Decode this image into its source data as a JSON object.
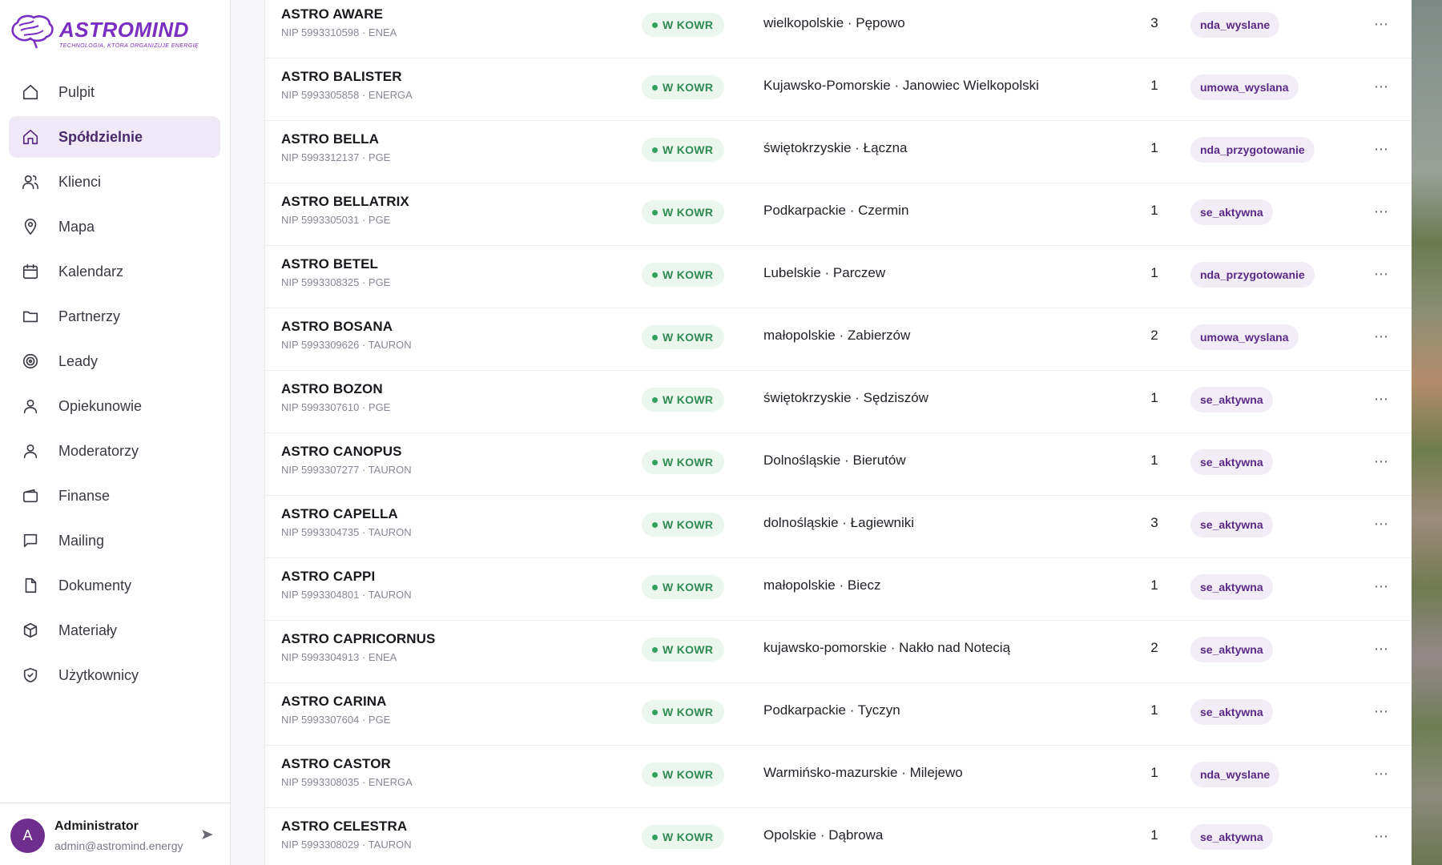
{
  "brand": {
    "name": "ASTROMIND",
    "tagline": "TECHNOLOGIA, KTÓRA ORGANIZUJE ENERGIĘ",
    "color": "#7a2fc2"
  },
  "sidebar": {
    "items": [
      {
        "label": "Pulpit",
        "icon": "home-icon"
      },
      {
        "label": "Spółdzielnie",
        "icon": "house-icon",
        "active": true
      },
      {
        "label": "Klienci",
        "icon": "users-icon"
      },
      {
        "label": "Mapa",
        "icon": "map-pin-icon"
      },
      {
        "label": "Kalendarz",
        "icon": "calendar-icon"
      },
      {
        "label": "Partnerzy",
        "icon": "folder-icon"
      },
      {
        "label": "Leady",
        "icon": "target-icon"
      },
      {
        "label": "Opiekunowie",
        "icon": "user-icon"
      },
      {
        "label": "Moderatorzy",
        "icon": "user-icon"
      },
      {
        "label": "Finanse",
        "icon": "wallet-icon"
      },
      {
        "label": "Mailing",
        "icon": "message-icon"
      },
      {
        "label": "Dokumenty",
        "icon": "file-icon"
      },
      {
        "label": "Materiały",
        "icon": "box-icon"
      },
      {
        "label": "Użytkownicy",
        "icon": "shield-icon"
      }
    ]
  },
  "user": {
    "initial": "A",
    "name": "Administrator",
    "email": "admin@astromind.energy"
  },
  "rows": [
    {
      "name": "ASTRO AWARE",
      "sub": "NIP 5993310598 · ENEA",
      "status": "W KOWR",
      "location": "wielkopolskie · Pępowo",
      "count": "3",
      "tag": "nda_wyslane"
    },
    {
      "name": "ASTRO BALISTER",
      "sub": "NIP 5993305858 · ENERGA",
      "status": "W KOWR",
      "location": "Kujawsko-Pomorskie · Janowiec Wielkopolski",
      "count": "1",
      "tag": "umowa_wyslana"
    },
    {
      "name": "ASTRO BELLA",
      "sub": "NIP 5993312137 · PGE",
      "status": "W KOWR",
      "location": "świętokrzyskie · Łączna",
      "count": "1",
      "tag": "nda_przygotowanie"
    },
    {
      "name": "ASTRO BELLATRIX",
      "sub": "NIP 5993305031 · PGE",
      "status": "W KOWR",
      "location": "Podkarpackie · Czermin",
      "count": "1",
      "tag": "se_aktywna"
    },
    {
      "name": "ASTRO BETEL",
      "sub": "NIP 5993308325 · PGE",
      "status": "W KOWR",
      "location": "Lubelskie · Parczew",
      "count": "1",
      "tag": "nda_przygotowanie"
    },
    {
      "name": "ASTRO BOSANA",
      "sub": "NIP 5993309626 · TAURON",
      "status": "W KOWR",
      "location": "małopolskie · Zabierzów",
      "count": "2",
      "tag": "umowa_wyslana"
    },
    {
      "name": "ASTRO BOZON",
      "sub": "NIP 5993307610 · PGE",
      "status": "W KOWR",
      "location": "świętokrzyskie · Sędziszów",
      "count": "1",
      "tag": "se_aktywna"
    },
    {
      "name": "ASTRO CANOPUS",
      "sub": "NIP 5993307277 · TAURON",
      "status": "W KOWR",
      "location": "Dolnośląskie · Bierutów",
      "count": "1",
      "tag": "se_aktywna"
    },
    {
      "name": "ASTRO CAPELLA",
      "sub": "NIP 5993304735 · TAURON",
      "status": "W KOWR",
      "location": "dolnośląskie · Łagiewniki",
      "count": "3",
      "tag": "se_aktywna"
    },
    {
      "name": "ASTRO CAPPI",
      "sub": "NIP 5993304801 · TAURON",
      "status": "W KOWR",
      "location": "małopolskie · Biecz",
      "count": "1",
      "tag": "se_aktywna"
    },
    {
      "name": "ASTRO CAPRICORNUS",
      "sub": "NIP 5993304913 · ENEA",
      "status": "W KOWR",
      "location": "kujawsko-pomorskie · Nakło nad Notecią",
      "count": "2",
      "tag": "se_aktywna"
    },
    {
      "name": "ASTRO CARINA",
      "sub": "NIP 5993307604 · PGE",
      "status": "W KOWR",
      "location": "Podkarpackie · Tyczyn",
      "count": "1",
      "tag": "se_aktywna"
    },
    {
      "name": "ASTRO CASTOR",
      "sub": "NIP 5993308035 · ENERGA",
      "status": "W KOWR",
      "location": "Warmińsko-mazurskie · Milejewo",
      "count": "1",
      "tag": "nda_wyslane"
    },
    {
      "name": "ASTRO CELESTRA",
      "sub": "NIP 5993308029 · TAURON",
      "status": "W KOWR",
      "location": "Opolskie · Dąbrowa",
      "count": "1",
      "tag": "se_aktywna"
    }
  ],
  "colors": {
    "accent": "#5b2a86",
    "status_green": "#2f8a52",
    "status_bg": "#eaf6ee",
    "tag_bg": "#f1ecf6"
  }
}
